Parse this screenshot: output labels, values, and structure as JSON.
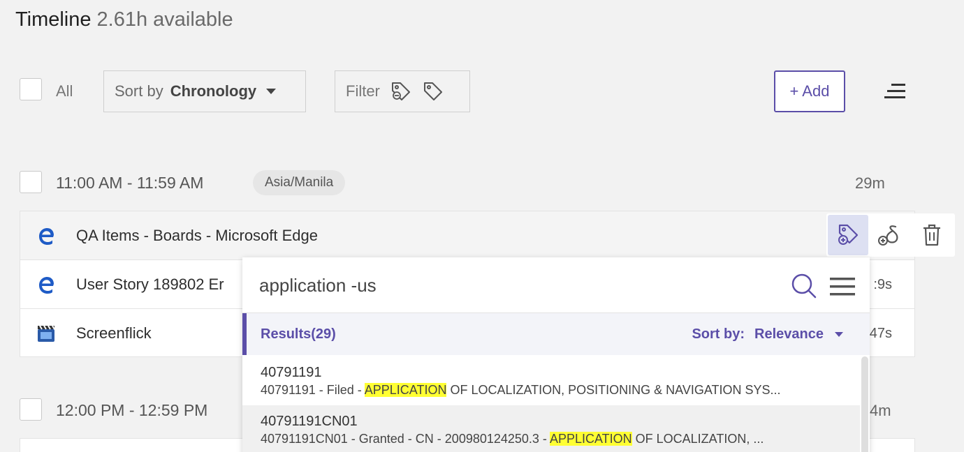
{
  "header": {
    "title": "Timeline",
    "available": "2.61h available"
  },
  "toolbar": {
    "select_all_label": "All",
    "sort_prefix": "Sort by",
    "sort_value": "Chronology",
    "filter_label": "Filter",
    "add_label": "+ Add"
  },
  "groups": [
    {
      "time_range": "11:00 AM - 11:59 AM",
      "timezone": "Asia/Manila",
      "duration": "29m",
      "entries": [
        {
          "name": "QA Items - Boards - Microsoft Edge",
          "icon": "edge-icon",
          "duration": ""
        },
        {
          "name": "User Story 189802 Er",
          "icon": "edge-icon",
          "duration": ":9s"
        },
        {
          "name": "Screenflick",
          "icon": "screenflick-icon",
          "duration": "47s"
        }
      ]
    },
    {
      "time_range": "12:00 PM - 12:59 PM",
      "duration": "4m"
    }
  ],
  "popup": {
    "search_value": "application -us",
    "results_label": "Results(29)",
    "sort_label": "Sort by:",
    "sort_value": "Relevance",
    "results": [
      {
        "title": "40791191",
        "desc_before": "40791191 - Filed - ",
        "highlight": "APPLICATION",
        "desc_after": " OF LOCALIZATION, POSITIONING & NAVIGATION SYS..."
      },
      {
        "title": "40791191CN01",
        "desc_before": "40791191CN01 - Granted - CN - 200980124250.3 - ",
        "highlight": "APPLICATION",
        "desc_after": " OF LOCALIZATION, ..."
      }
    ]
  },
  "colors": {
    "accent": "#5b4ea8",
    "highlight": "#ffff33",
    "edge_blue": "#1e5bc6"
  }
}
